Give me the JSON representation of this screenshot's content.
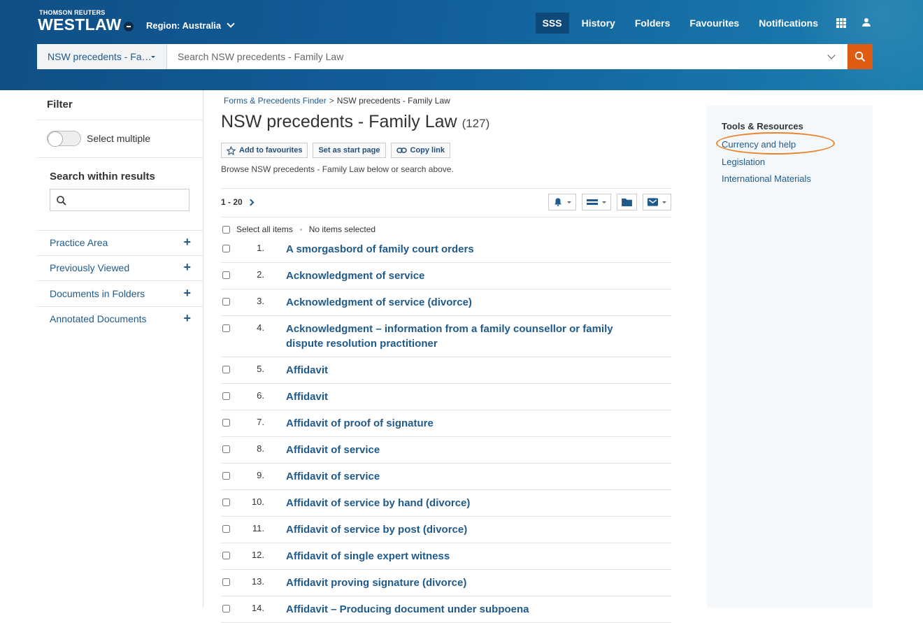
{
  "header": {
    "brand_top": "THOMSON REUTERS",
    "brand_main": "WESTLAW",
    "region": "Region: Australia",
    "nav": [
      "SSS",
      "History",
      "Folders",
      "Favourites",
      "Notifications"
    ],
    "nav_active": "SSS",
    "search": {
      "scope": "NSW precedents - Fa…",
      "placeholder": "Search NSW precedents - Family Law",
      "value": ""
    }
  },
  "sidebar": {
    "filter_title": "Filter",
    "select_multiple": "Select multiple",
    "select_multiple_on": false,
    "search_within_title": "Search within results",
    "search_within_value": "",
    "facets": [
      "Practice Area",
      "Previously Viewed",
      "Documents in Folders",
      "Annotated Documents"
    ]
  },
  "main": {
    "breadcrumb": [
      "Forms & Precedents Finder",
      "NSW precedents - Family Law"
    ],
    "breadcrumb_sep": ">",
    "title": "NSW precedents - Family Law",
    "count": "(127)",
    "actions": [
      "Add to favourites",
      "Set as start page",
      "Copy link"
    ],
    "browse_text": "Browse NSW precedents - Family Law below or search above.",
    "pager": "1 - 20",
    "select_all": "Select all items",
    "selected_status": "No items selected",
    "results": [
      {
        "num": "1.",
        "title": "A smorgasbord of family court orders"
      },
      {
        "num": "2.",
        "title": "Acknowledgment of service"
      },
      {
        "num": "3.",
        "title": "Acknowledgment of service (divorce)"
      },
      {
        "num": "4.",
        "title": "Acknowledgment – information from a family counsellor or family dispute resolution practitioner"
      },
      {
        "num": "5.",
        "title": "Affidavit"
      },
      {
        "num": "6.",
        "title": "Affidavit"
      },
      {
        "num": "7.",
        "title": "Affidavit of proof of signature"
      },
      {
        "num": "8.",
        "title": "Affidavit of service"
      },
      {
        "num": "9.",
        "title": "Affidavit of service"
      },
      {
        "num": "10.",
        "title": "Affidavit of service by hand (divorce)"
      },
      {
        "num": "11.",
        "title": "Affidavit of service by post (divorce)"
      },
      {
        "num": "12.",
        "title": "Affidavit of single expert witness"
      },
      {
        "num": "13.",
        "title": "Affidavit proving signature (divorce)"
      },
      {
        "num": "14.",
        "title": "Affidavit – Producing document under subpoena"
      }
    ]
  },
  "tools_resources": {
    "title": "Tools & Resources",
    "links": [
      "Currency and help",
      "Legislation",
      "International Materials"
    ],
    "highlighted": "Currency and help"
  },
  "colors": {
    "header_blue": "#125e9a",
    "link_blue": "#1f5a8a",
    "search_orange": "#e05b12",
    "highlight_orange": "#e9842c"
  }
}
